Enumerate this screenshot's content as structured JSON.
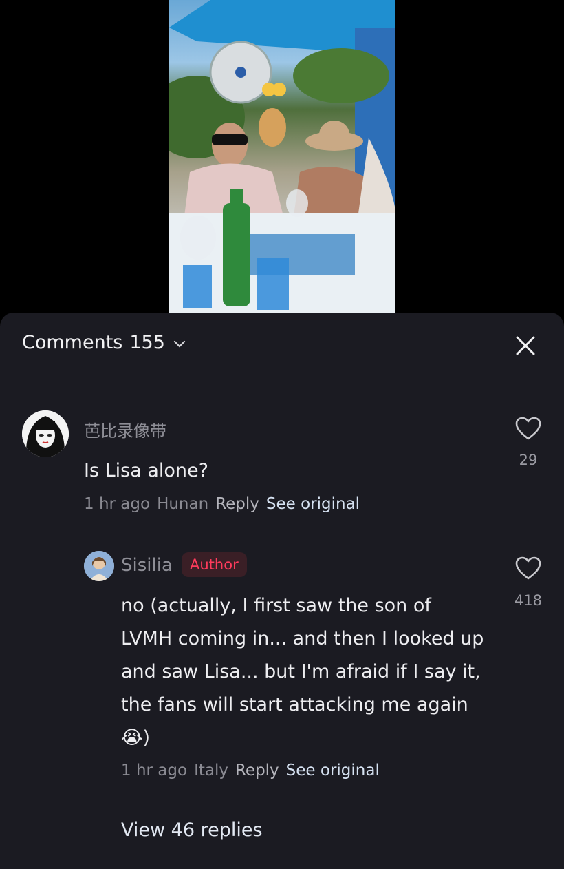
{
  "comments_header": {
    "title": "Comments",
    "count": "155"
  },
  "comments": [
    {
      "username": "芭比录像带",
      "text": "Is Lisa alone?",
      "time": "1 hr ago",
      "location": "Hunan",
      "reply_label": "Reply",
      "see_original_label": "See original",
      "likes": "29"
    }
  ],
  "reply": {
    "username": "Sisilia",
    "badge": "Author",
    "text": "no (actually, I first saw the son of LVMH coming in... and then I looked up and saw Lisa... but I'm afraid if I say it, the fans will start attacking me again 😭)",
    "time": "1 hr ago",
    "location": "Italy",
    "reply_label": "Reply",
    "see_original_label": "See original",
    "likes": "418"
  },
  "view_replies": "View 46 replies",
  "colors": {
    "sheet_bg": "#1b1b22",
    "author_red": "#ff3b5c",
    "link": "#d6e2f2"
  }
}
